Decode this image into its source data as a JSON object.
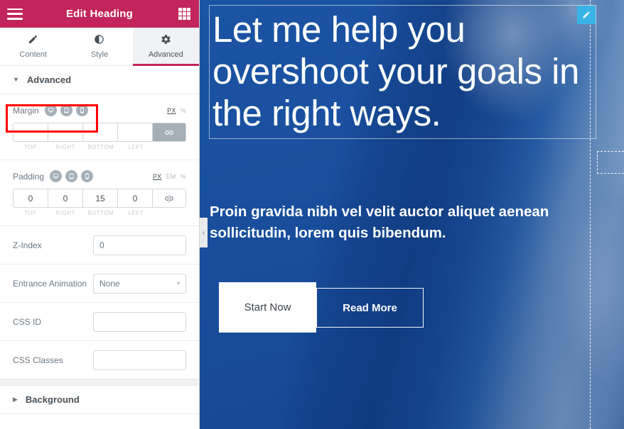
{
  "panel": {
    "title": "Edit Heading",
    "menu_icon": "hamburger-icon",
    "widgets_icon": "grid-icon",
    "tabs": [
      {
        "label": "Content",
        "icon": "pencil-icon",
        "active": false
      },
      {
        "label": "Style",
        "icon": "contrast-icon",
        "active": false
      },
      {
        "label": "Advanced",
        "icon": "gear-icon",
        "active": true
      }
    ],
    "sections": {
      "advanced": {
        "title": "Advanced",
        "caret": "▼",
        "expanded": true
      },
      "background": {
        "title": "Background",
        "caret": "▶",
        "expanded": false
      }
    },
    "margin": {
      "label": "Margin",
      "devices": [
        "desktop-icon",
        "tablet-icon",
        "mobile-icon"
      ],
      "units": [
        {
          "label": "PX",
          "active": true
        },
        {
          "label": "%",
          "active": false
        }
      ],
      "values": {
        "top": "",
        "right": "",
        "bottom": "",
        "left": ""
      },
      "legend": [
        "TOP",
        "RIGHT",
        "BOTTOM",
        "LEFT"
      ],
      "link_icon": "link-icon",
      "linked": true
    },
    "padding": {
      "label": "Padding",
      "devices": [
        "desktop-icon",
        "tablet-icon",
        "mobile-icon"
      ],
      "units": [
        {
          "label": "PX",
          "active": true
        },
        {
          "label": "EM",
          "active": false
        },
        {
          "label": "%",
          "active": false
        }
      ],
      "values": {
        "top": "0",
        "right": "0",
        "bottom": "15",
        "left": "0"
      },
      "legend": [
        "TOP",
        "RIGHT",
        "BOTTOM",
        "LEFT"
      ],
      "link_icon": "broken-link-icon",
      "linked": false
    },
    "z_index": {
      "label": "Z-Index",
      "value": "0"
    },
    "entrance_animation": {
      "label": "Entrance Animation",
      "value": "None",
      "arrow": "▾"
    },
    "css_id": {
      "label": "CSS ID",
      "value": "",
      "placeholder": ""
    },
    "css_classes": {
      "label": "CSS Classes",
      "value": "",
      "placeholder": ""
    }
  },
  "canvas": {
    "heading": "Let me help you overshoot your goals in the right ways.",
    "edit_badge_icon": "pencil-icon",
    "subheading": "Proin gravida nibh vel velit auctor aliquet aenean sollicitudin, lorem quis bibendum.",
    "buttons": [
      {
        "label": "Start Now",
        "style": "solid"
      },
      {
        "label": "Read More",
        "style": "outline"
      }
    ],
    "collapse_icon": "‹"
  },
  "colors": {
    "brand_magenta": "#c2255c",
    "panel_bg": "#ffffff",
    "text_muted": "#6d7882",
    "text_dark": "#495157",
    "border": "#d5d8dc",
    "device_toggle": "#a4afb7",
    "edit_badge": "#39b3e6",
    "highlight_red": "#ff0000",
    "hero_blue": "#1b4f9c"
  }
}
